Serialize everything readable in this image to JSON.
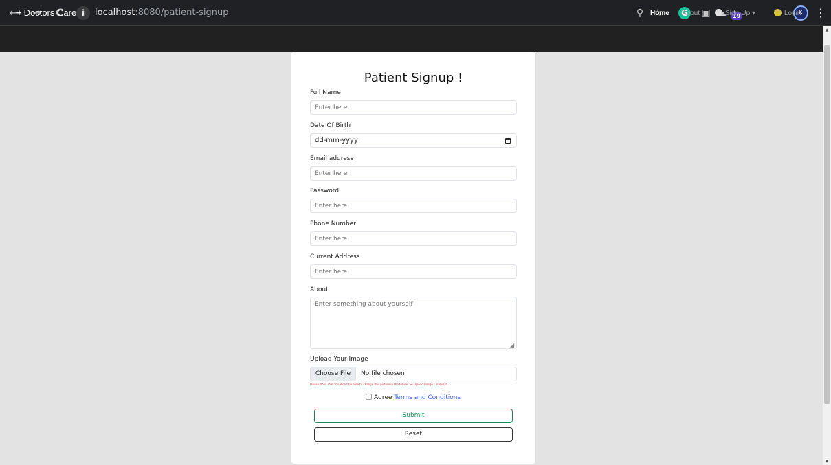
{
  "browser": {
    "back_icon": "←",
    "forward_icon": "→",
    "reload_icon": "C",
    "url_host": "localhost",
    "url_path": ":8080/patient-signup",
    "zoom_icon": "⚲",
    "star_icon": "☆",
    "grammarly_icon": "G",
    "extension_badge": "19",
    "avatar_initial": "K",
    "menu_icon": "⋮"
  },
  "navbar": {
    "brand": "Doctors Care",
    "brand_icon": "+",
    "home": "Home",
    "about": "About",
    "signup": "Sign-Up",
    "signup_caret": "▾",
    "login": "Login"
  },
  "form": {
    "title": "Patient Signup !",
    "full_name_label": "Full Name",
    "full_name_placeholder": "Enter here",
    "dob_label": "Date Of Birth",
    "dob_value": "dd-mm-yyyy",
    "email_label": "Email address",
    "email_placeholder": "Enter here",
    "password_label": "Password",
    "password_placeholder": "Enter here",
    "phone_label": "Phone Number",
    "phone_placeholder": "Enter here",
    "address_label": "Current Address",
    "address_placeholder": "Enter here",
    "about_label": "About",
    "about_placeholder": "Enter something about yourself",
    "upload_label": "Upload Your Image",
    "choose_file": "Choose File",
    "no_file": "No file chosen",
    "upload_note": "Please Note That You Won't be able to change this picture in the future. So Upload Image Carefully*",
    "agree_text": "Agree",
    "terms_link": "Terms and Conditions",
    "submit": "Submit",
    "reset": "Reset"
  }
}
